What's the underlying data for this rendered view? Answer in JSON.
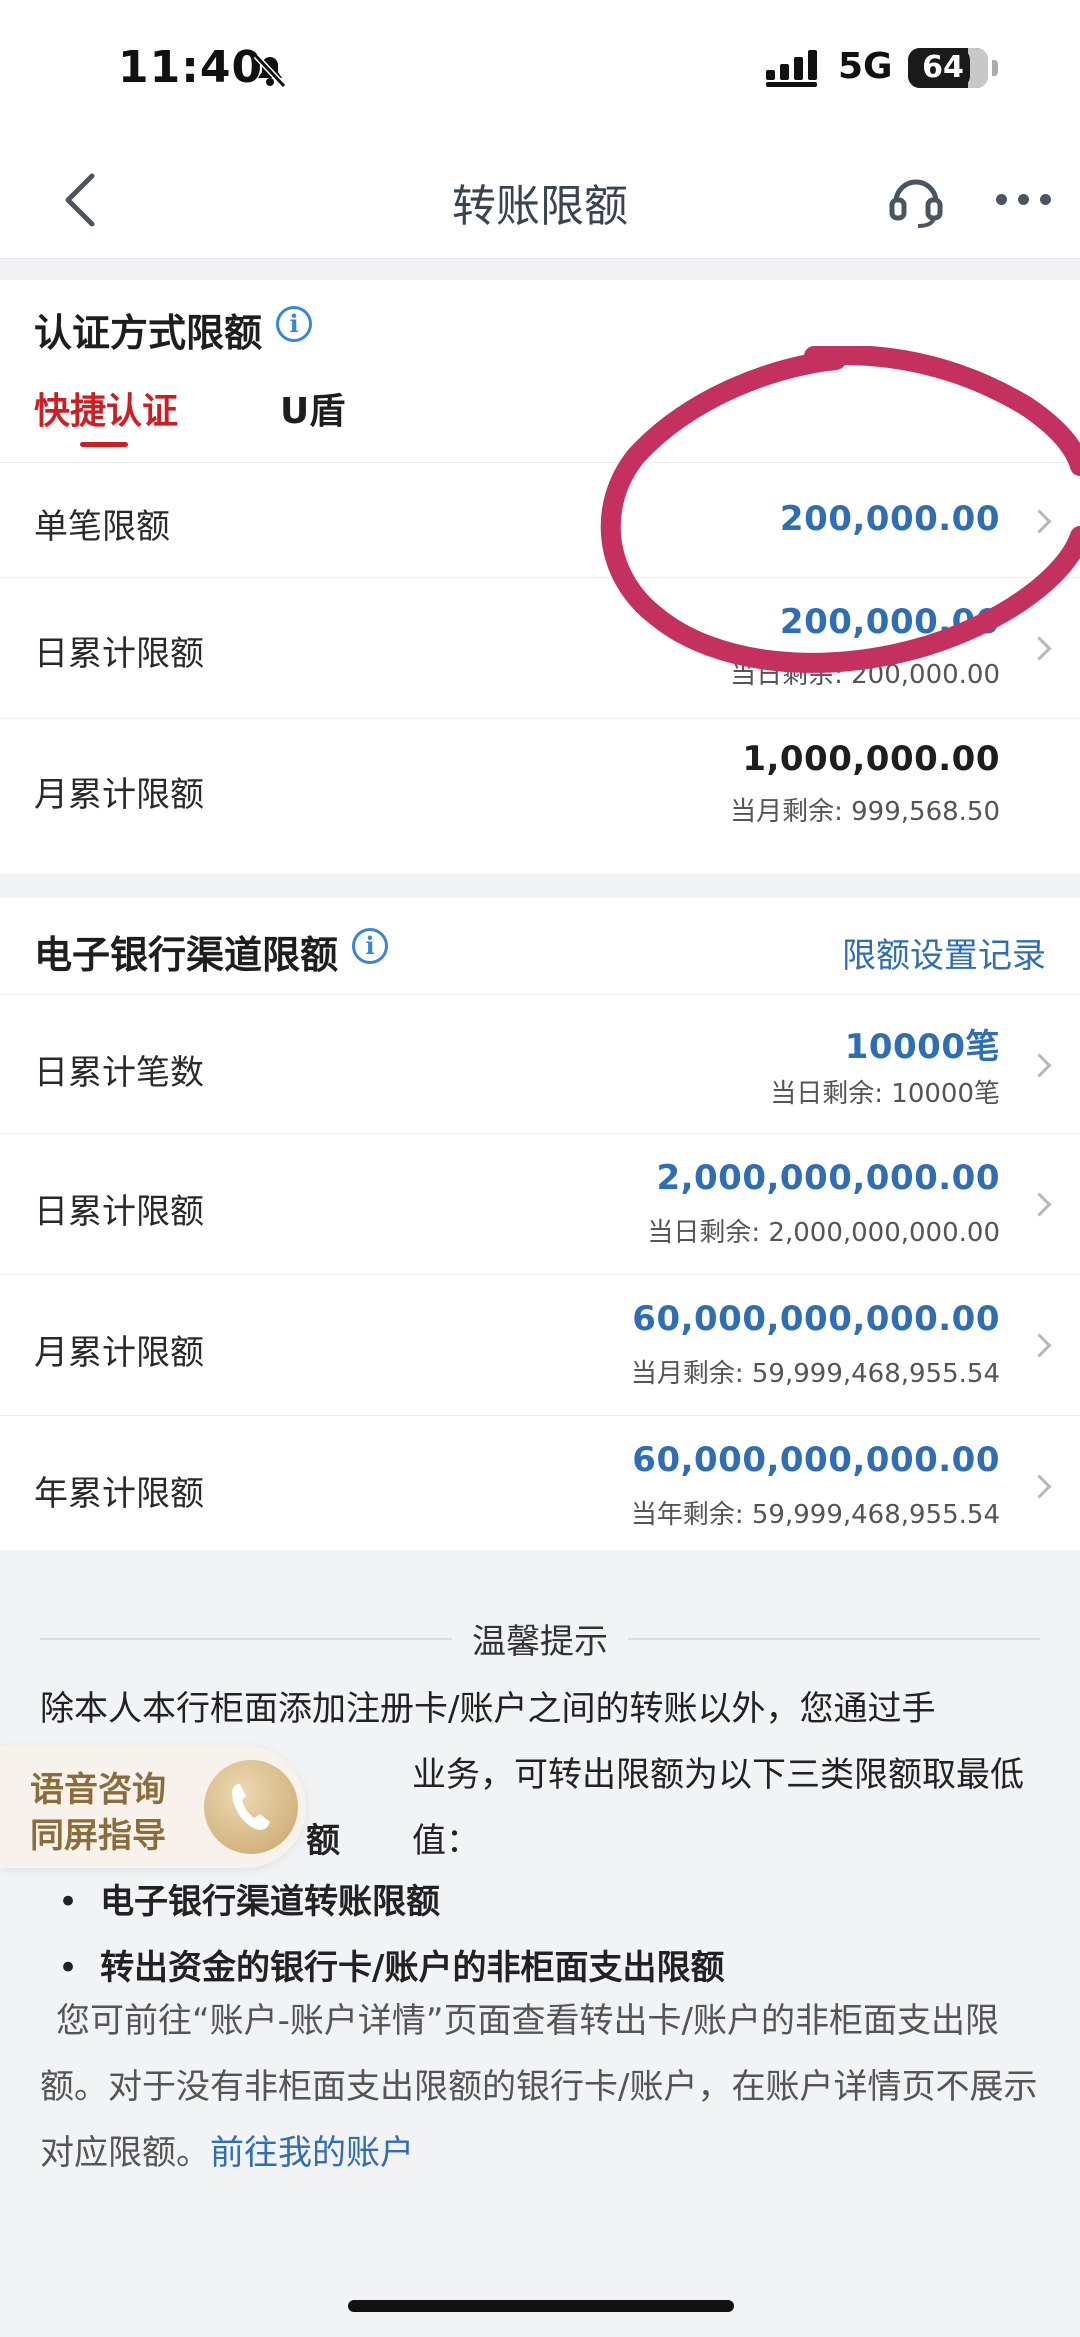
{
  "status": {
    "time": "11:40",
    "network": "5G",
    "battery": "64"
  },
  "nav": {
    "title": "转账限额"
  },
  "auth_section": {
    "title": "认证方式限额",
    "tabs": [
      {
        "label": "快捷认证",
        "active": true
      },
      {
        "label": "U盾",
        "active": false
      }
    ],
    "rows": [
      {
        "label": "单笔限额",
        "value": "200,000.00",
        "sub": ""
      },
      {
        "label": "日累计限额",
        "value": "200,000.00",
        "sub": "当日剩余: 200,000.00"
      },
      {
        "label": "月累计限额",
        "value": "1,000,000.00",
        "sub": "当月剩余: 999,568.50"
      }
    ]
  },
  "channel_section": {
    "title": "电子银行渠道限额",
    "record_link": "限额设置记录",
    "rows": [
      {
        "label": "日累计笔数",
        "value": "10000笔",
        "sub": "当日剩余: 10000笔"
      },
      {
        "label": "日累计限额",
        "value": "2,000,000,000.00",
        "sub": "当日剩余: 2,000,000,000.00"
      },
      {
        "label": "月累计限额",
        "value": "60,000,000,000.00",
        "sub": "当月剩余: 59,999,468,955.54"
      },
      {
        "label": "年累计限额",
        "value": "60,000,000,000.00",
        "sub": "当年剩余: 59,999,468,955.54"
      }
    ]
  },
  "tips": {
    "title": "温馨提示",
    "line1": "除本人本行柜面添加注册卡/账户之间的转账以外，您通过手",
    "line2": "业务，可转出限额为以下三类限额取最低值：",
    "bullet1_fragment": "额",
    "bullet2": "电子银行渠道转账限额",
    "bullet3": "转出资金的银行卡/账户的非柜面支出限额",
    "note": "您可前往“账户-账户详情”页面查看转出卡/账户的非柜面支出限额。对于没有非柜面支出限额的银行卡/账户，在账户详情页不展示对应限额。",
    "link": "前往我的账户"
  },
  "voice_consult": {
    "line1": "语音咨询",
    "line2": "同屏指导"
  },
  "colors": {
    "accent_blue": "#2f6db5",
    "active_red": "#cc1f25",
    "annotation": "#c4315f"
  }
}
